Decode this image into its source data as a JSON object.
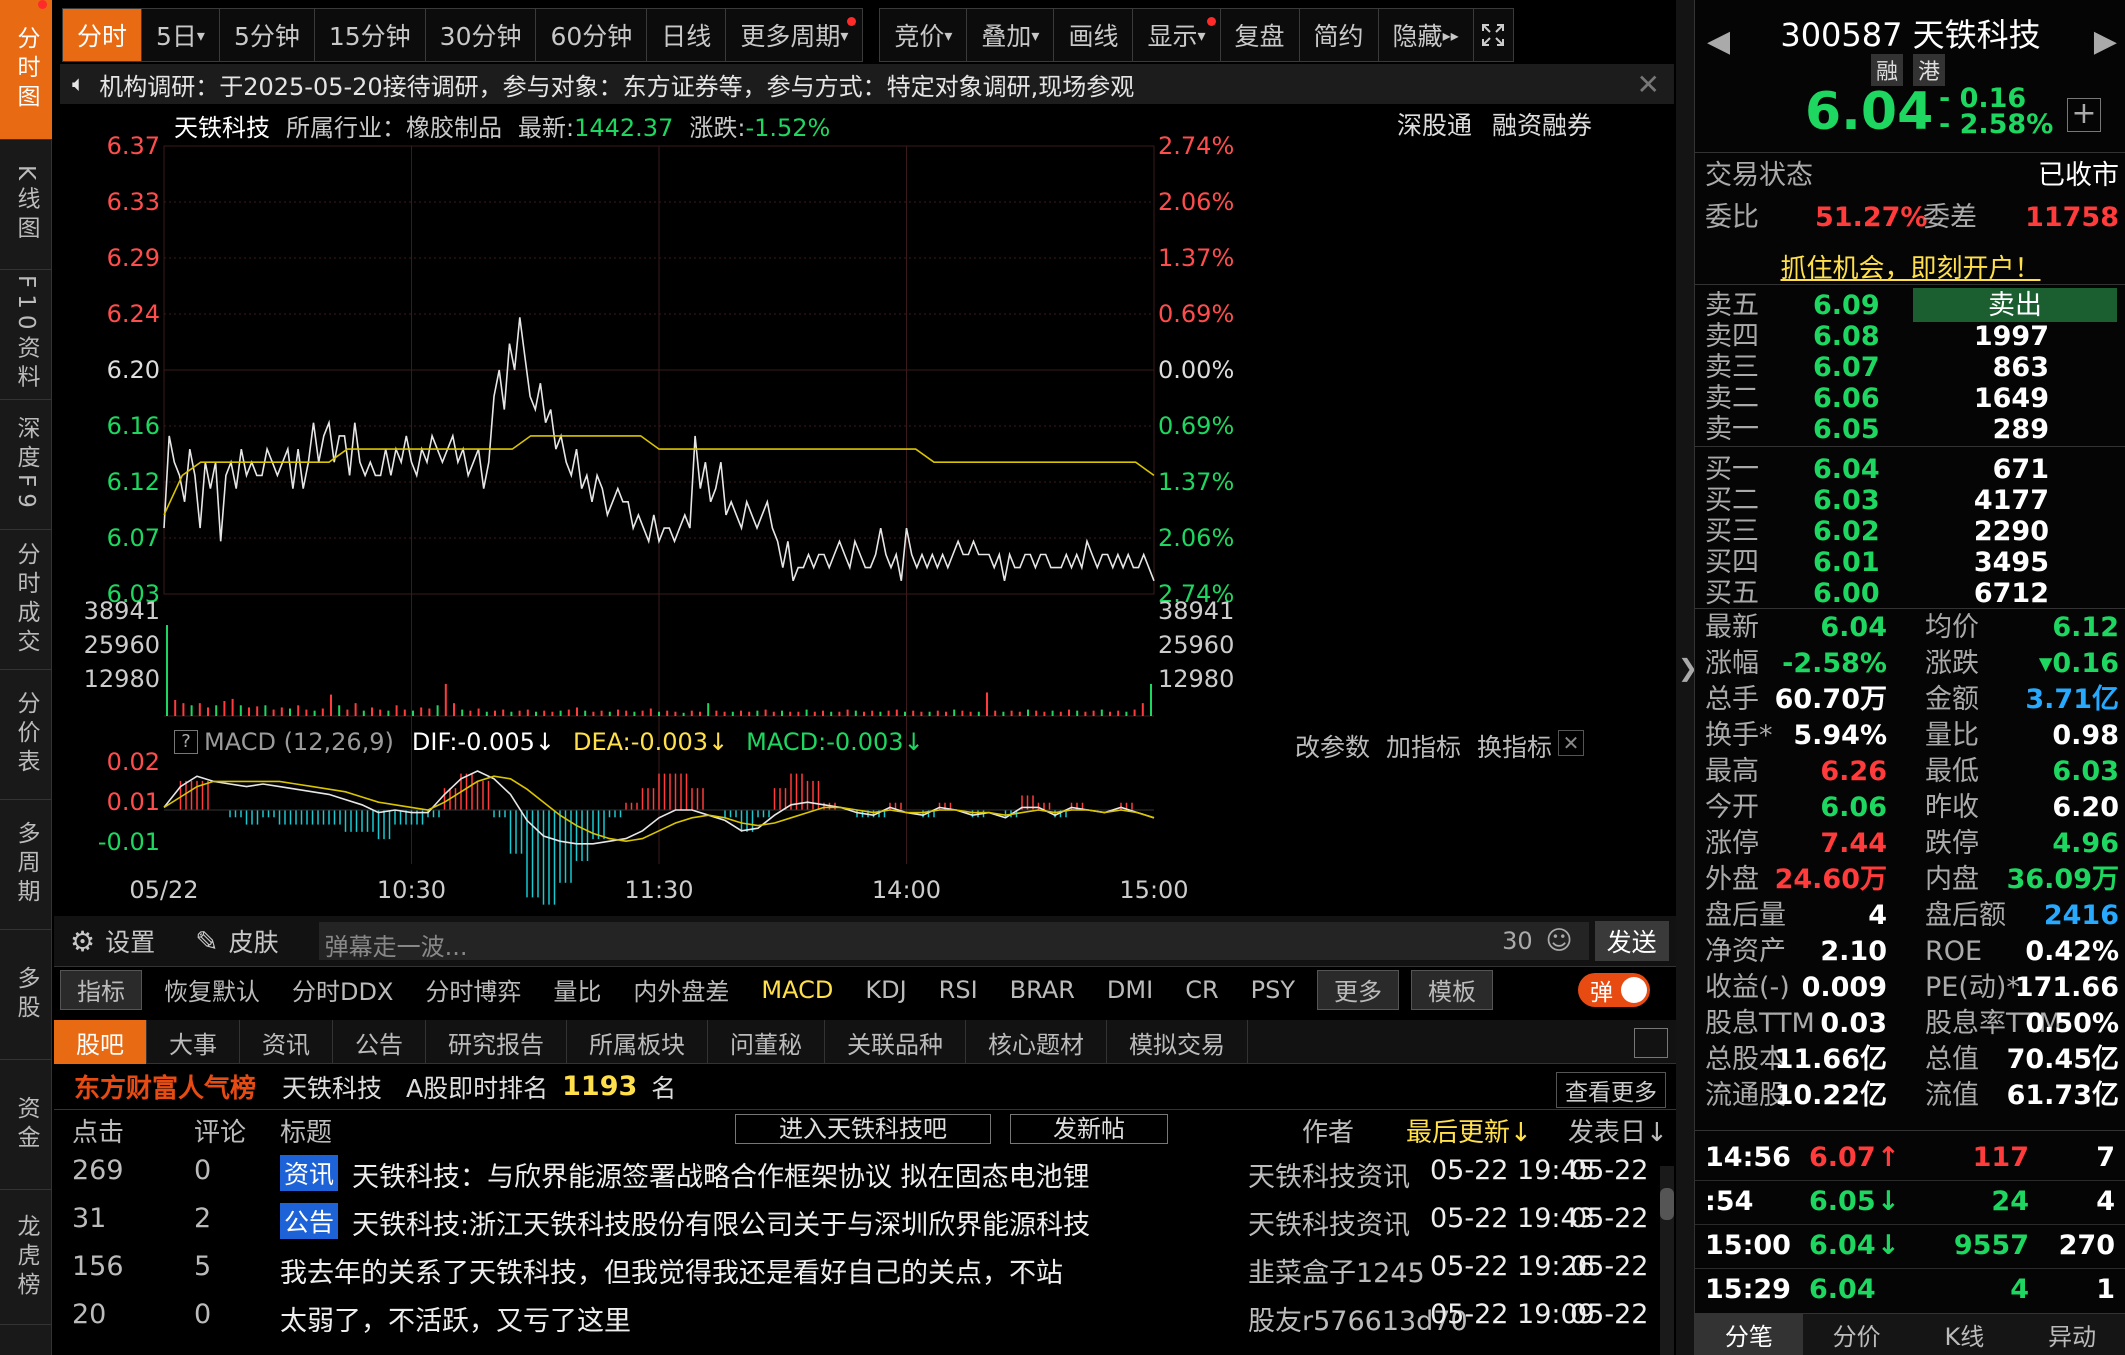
{
  "lnav": [
    {
      "label": "分时图",
      "active": true,
      "h": 140
    },
    {
      "label": "K线图",
      "active": false,
      "h": 130
    },
    {
      "label": "F10资料",
      "active": false,
      "h": 130
    },
    {
      "label": "深度F9",
      "active": false,
      "h": 130
    },
    {
      "label": "分时成交",
      "active": false,
      "h": 140
    },
    {
      "label": "分价表",
      "active": false,
      "h": 130
    },
    {
      "label": "多周期",
      "active": false,
      "h": 130
    },
    {
      "label": "多股",
      "active": false,
      "h": 130
    },
    {
      "label": "资金",
      "active": false,
      "h": 130
    },
    {
      "label": "龙虎榜",
      "active": false,
      "h": 135
    }
  ],
  "period_tabs": [
    "分时",
    "5日",
    "5分钟",
    "15分钟",
    "30分钟",
    "60分钟",
    "日线",
    "更多周期"
  ],
  "tool_tabs": [
    "竞价",
    "叠加",
    "画线",
    "显示",
    "复盘",
    "简约",
    "隐藏"
  ],
  "notice": "机构调研：于2025-05-20接待调研，参与对象：东方证券等，参与方式：特定对象调研,现场参观",
  "chart_header": {
    "name": "天铁科技",
    "industry": "所属行业：橡胶制品",
    "latest_label": "最新:",
    "latest": "1442.37",
    "change_label": "涨跌:",
    "change": "-1.52%",
    "links": [
      "深股通",
      "融资融券"
    ]
  },
  "chart_data": {
    "type": "line",
    "price_ticks": [
      "6.37",
      "6.33",
      "6.29",
      "6.24",
      "6.20",
      "6.16",
      "6.12",
      "6.07",
      "6.03"
    ],
    "pct_ticks": [
      "2.74%",
      "2.06%",
      "1.37%",
      "0.69%",
      "0.00%",
      "0.69%",
      "1.37%",
      "2.06%",
      "2.74%"
    ],
    "ylim": [
      6.03,
      6.37
    ],
    "vol_ticks": [
      "38941",
      "25960",
      "12980"
    ],
    "macd_ticks": [
      "0.02",
      "0.01",
      "-0.01"
    ],
    "x_ticks": [
      "05/22",
      "10:30",
      "11:30",
      "14:00",
      "15:00"
    ],
    "price_series": [
      6.08,
      6.15,
      6.13,
      6.12,
      6.1,
      6.14,
      6.12,
      6.08,
      6.13,
      6.11,
      6.13,
      6.07,
      6.12,
      6.13,
      6.11,
      6.14,
      6.12,
      6.13,
      6.12,
      6.12,
      6.14,
      6.13,
      6.12,
      6.13,
      6.14,
      6.11,
      6.14,
      6.11,
      6.13,
      6.16,
      6.13,
      6.15,
      6.16,
      6.13,
      6.15,
      6.15,
      6.12,
      6.16,
      6.13,
      6.12,
      6.13,
      6.12,
      6.12,
      6.14,
      6.12,
      6.14,
      6.13,
      6.15,
      6.13,
      6.12,
      6.14,
      6.13,
      6.15,
      6.14,
      6.13,
      6.14,
      6.15,
      6.13,
      6.14,
      6.12,
      6.13,
      6.14,
      6.11,
      6.13,
      6.18,
      6.2,
      6.17,
      6.22,
      6.2,
      6.24,
      6.21,
      6.18,
      6.17,
      6.19,
      6.16,
      6.17,
      6.14,
      6.15,
      6.13,
      6.12,
      6.14,
      6.11,
      6.12,
      6.1,
      6.12,
      6.11,
      6.09,
      6.1,
      6.11,
      6.1,
      6.1,
      6.08,
      6.09,
      6.08,
      6.07,
      6.09,
      6.07,
      6.08,
      6.08,
      6.07,
      6.08,
      6.09,
      6.08,
      6.15,
      6.11,
      6.13,
      6.1,
      6.11,
      6.13,
      6.09,
      6.1,
      6.09,
      6.08,
      6.1,
      6.09,
      6.08,
      6.09,
      6.1,
      6.08,
      6.07,
      6.05,
      6.07,
      6.04,
      6.05,
      6.05,
      6.06,
      6.05,
      6.06,
      6.06,
      6.05,
      6.06,
      6.07,
      6.06,
      6.05,
      6.07,
      6.06,
      6.05,
      6.05,
      6.06,
      6.08,
      6.06,
      6.05,
      6.06,
      6.04,
      6.08,
      6.06,
      6.05,
      6.06,
      6.05,
      6.06,
      6.05,
      6.06,
      6.05,
      6.06,
      6.07,
      6.06,
      6.06,
      6.07,
      6.06,
      6.06,
      6.06,
      6.05,
      6.06,
      6.04,
      6.06,
      6.05,
      6.05,
      6.06,
      6.06,
      6.05,
      6.06,
      6.06,
      6.05,
      6.05,
      6.05,
      6.06,
      6.05,
      6.06,
      6.05,
      6.07,
      6.06,
      6.05,
      6.06,
      6.06,
      6.05,
      6.06,
      6.05,
      6.06,
      6.05,
      6.05,
      6.06,
      6.05,
      6.04
    ],
    "avg_series": [
      6.09,
      6.12,
      6.13,
      6.13,
      6.13,
      6.13,
      6.13,
      6.13,
      6.13,
      6.13,
      6.14,
      6.14,
      6.14,
      6.14,
      6.14,
      6.14,
      6.14,
      6.14,
      6.14,
      6.14,
      6.15,
      6.15,
      6.15,
      6.15,
      6.15,
      6.15,
      6.15,
      6.14,
      6.14,
      6.14,
      6.14,
      6.14,
      6.14,
      6.14,
      6.14,
      6.14,
      6.14,
      6.14,
      6.14,
      6.14,
      6.14,
      6.14,
      6.13,
      6.13,
      6.13,
      6.13,
      6.13,
      6.13,
      6.13,
      6.13,
      6.13,
      6.13,
      6.13,
      6.13,
      6.12
    ],
    "vol_series": [
      0.85,
      0.15,
      0.12,
      0.1,
      0.12,
      0.08,
      0.1,
      0.14,
      0.16,
      0.1,
      0.08,
      0.09,
      0.1,
      0.06,
      0.08,
      0.07,
      0.1,
      0.06,
      0.05,
      0.07,
      0.2,
      0.1,
      0.06,
      0.12,
      0.05,
      0.08,
      0.06,
      0.05,
      0.1,
      0.06,
      0.05,
      0.08,
      0.07,
      0.1,
      0.3,
      0.12,
      0.06,
      0.05,
      0.07,
      0.04,
      0.05,
      0.06,
      0.04,
      0.05,
      0.06,
      0.04,
      0.05,
      0.04,
      0.05,
      0.06,
      0.08,
      0.05,
      0.04,
      0.05,
      0.04,
      0.06,
      0.05,
      0.04,
      0.05,
      0.07,
      0.04,
      0.05,
      0.04,
      0.03,
      0.05,
      0.04,
      0.12,
      0.05,
      0.04,
      0.04,
      0.05,
      0.04,
      0.05,
      0.06,
      0.04,
      0.05,
      0.04,
      0.04,
      0.06,
      0.04,
      0.05,
      0.04,
      0.04,
      0.06,
      0.05,
      0.04,
      0.05,
      0.04,
      0.05,
      0.06,
      0.04,
      0.05,
      0.04,
      0.04,
      0.05,
      0.04,
      0.06,
      0.05,
      0.04,
      0.04,
      0.22,
      0.05,
      0.04,
      0.05,
      0.04,
      0.06,
      0.05,
      0.04,
      0.05,
      0.04,
      0.06,
      0.05,
      0.04,
      0.05,
      0.06,
      0.04,
      0.05,
      0.04,
      0.06,
      0.12,
      0.3
    ],
    "dif_series": [
      0.001,
      0.009,
      0.013,
      0.011,
      0.01,
      0.009,
      0.01,
      0.009,
      0.008,
      0.007,
      0.006,
      0.004,
      0.002,
      -0.001,
      0.0,
      -0.001,
      -0.001,
      0.006,
      0.012,
      0.015,
      0.012,
      0.006,
      -0.004,
      -0.01,
      -0.012,
      -0.013,
      -0.013,
      -0.012,
      -0.011,
      -0.008,
      -0.003,
      -0.0,
      0.0,
      -0.002,
      -0.004,
      -0.008,
      -0.007,
      -0.002,
      0.002,
      0.003,
      0.002,
      0.001,
      -0.001,
      -0.002,
      0.001,
      -0.001,
      -0.002,
      0.001,
      0.0,
      -0.002,
      -0.001,
      -0.003,
      0.001,
      0.001,
      -0.002,
      0.001,
      0.0,
      -0.001,
      0.001,
      -0.001,
      -0.003
    ],
    "dea_series": [
      0.001,
      0.005,
      0.009,
      0.011,
      0.011,
      0.011,
      0.011,
      0.011,
      0.01,
      0.009,
      0.008,
      0.007,
      0.005,
      0.003,
      0.002,
      0.001,
      0.0,
      0.003,
      0.007,
      0.011,
      0.013,
      0.012,
      0.008,
      0.003,
      -0.002,
      -0.006,
      -0.009,
      -0.011,
      -0.012,
      -0.011,
      -0.008,
      -0.005,
      -0.003,
      -0.002,
      -0.003,
      -0.005,
      -0.006,
      -0.005,
      -0.003,
      -0.001,
      0.001,
      0.001,
      0.0,
      -0.001,
      0.0,
      -0.001,
      -0.001,
      0.0,
      0.0,
      -0.001,
      -0.001,
      -0.002,
      -0.001,
      0.0,
      -0.001,
      0.0,
      0.0,
      -0.001,
      0.0,
      -0.001,
      -0.003
    ]
  },
  "macd_header": {
    "title": "MACD (12,26,9)",
    "dif": "DIF:-0.005↓",
    "dea": "DEA:-0.003↓",
    "macd": "MACD:-0.003↓",
    "actions": [
      "改参数",
      "加指标",
      "换指标"
    ]
  },
  "danmu": {
    "settings": "设置",
    "skin": "皮肤",
    "placeholder": "弹幕走一波...",
    "count": "30",
    "send": "发送"
  },
  "indicator_tabs": [
    "指标",
    "恢复默认",
    "分时DDX",
    "分时博弈",
    "量比",
    "内外盘差",
    "MACD",
    "KDJ",
    "RSI",
    "BRAR",
    "DMI",
    "CR",
    "PSY",
    "更多",
    "模板"
  ],
  "toggle_label": "弹",
  "info_tabs": [
    "股吧",
    "大事",
    "资讯",
    "公告",
    "研究报告",
    "所属板块",
    "问董秘",
    "关联品种",
    "核心题材",
    "模拟交易"
  ],
  "rank": {
    "brand": "东方财富人气榜",
    "name": "天铁科技",
    "label": "A股即时排名",
    "value": "1193",
    "unit": "名",
    "more": "查看更多"
  },
  "forum_header": {
    "clicks": "点击",
    "comments": "评论",
    "title": "标题",
    "enter": "进入天铁科技吧",
    "post": "发新帖",
    "author": "作者",
    "updated": "最后更新↓",
    "published": "发表日↓"
  },
  "forum_rows": [
    {
      "clicks": "269",
      "comments": "0",
      "tag": "资讯",
      "title": "天铁科技：与欣界能源签署战略合作框架协议 拟在固态电池锂",
      "author": "天铁科技资讯",
      "updated": "05-22 19:45",
      "date": "05-22"
    },
    {
      "clicks": "31",
      "comments": "2",
      "tag": "公告",
      "title": "天铁科技:浙江天铁科技股份有限公司关于与深圳欣界能源科技",
      "author": "天铁科技资讯",
      "updated": "05-22 19:43",
      "date": "05-22"
    },
    {
      "clicks": "156",
      "comments": "5",
      "tag": "",
      "title": "我去年的关系了天铁科技，但我觉得我还是看好自己的关点，不站",
      "author": "韭菜盒子1245",
      "updated": "05-22 19:26",
      "date": "05-22"
    },
    {
      "clicks": "20",
      "comments": "0",
      "tag": "",
      "title": "太弱了，不活跃，又亏了这里",
      "author": "股友r576613d70",
      "updated": "05-22 19:09",
      "date": "05-22"
    }
  ],
  "quote": {
    "code_name": "300587 天铁科技",
    "badges": [
      "融",
      "港"
    ],
    "price": "6.04",
    "chg": "- 0.16",
    "pct": "- 2.58%",
    "status_label": "交易状态",
    "status": "已收市",
    "wb_label": "委比",
    "wb": "51.27%",
    "wc_label": "委差",
    "wc": "11758",
    "promo": "抓住机会，即刻开户！",
    "sells": [
      {
        "l": "卖五",
        "p": "6.09",
        "v": "卖出"
      },
      {
        "l": "卖四",
        "p": "6.08",
        "v": "1997"
      },
      {
        "l": "卖三",
        "p": "6.07",
        "v": "863"
      },
      {
        "l": "卖二",
        "p": "6.06",
        "v": "1649"
      },
      {
        "l": "卖一",
        "p": "6.05",
        "v": "289"
      }
    ],
    "buys": [
      {
        "l": "买一",
        "p": "6.04",
        "v": "671"
      },
      {
        "l": "买二",
        "p": "6.03",
        "v": "4177"
      },
      {
        "l": "买三",
        "p": "6.02",
        "v": "2290"
      },
      {
        "l": "买四",
        "p": "6.01",
        "v": "3495"
      },
      {
        "l": "买五",
        "p": "6.00",
        "v": "6712"
      }
    ],
    "stats": [
      {
        "l1": "最新",
        "v1": "6.04",
        "c1": "grn",
        "l2": "均价",
        "v2": "6.12",
        "c2": "grn"
      },
      {
        "l1": "涨幅",
        "v1": "-2.58%",
        "c1": "grn",
        "l2": "涨跌",
        "v2": "▾0.16",
        "c2": "grn"
      },
      {
        "l1": "总手",
        "v1": "60.70万",
        "c1": "wht",
        "l2": "金额",
        "v2": "3.71亿",
        "c2": "cy"
      },
      {
        "l1": "换手*",
        "v1": "5.94%",
        "c1": "wht",
        "l2": "量比",
        "v2": "0.98",
        "c2": "wht"
      },
      {
        "l1": "最高",
        "v1": "6.26",
        "c1": "red",
        "l2": "最低",
        "v2": "6.03",
        "c2": "grn"
      },
      {
        "l1": "今开",
        "v1": "6.06",
        "c1": "grn",
        "l2": "昨收",
        "v2": "6.20",
        "c2": "wht"
      },
      {
        "l1": "涨停",
        "v1": "7.44",
        "c1": "red",
        "l2": "跌停",
        "v2": "4.96",
        "c2": "grn"
      },
      {
        "l1": "外盘",
        "v1": "24.60万",
        "c1": "red",
        "l2": "内盘",
        "v2": "36.09万",
        "c2": "grn"
      },
      {
        "l1": "盘后量",
        "v1": "4",
        "c1": "wht",
        "l2": "盘后额",
        "v2": "2416",
        "c2": "cy"
      },
      {
        "l1": "净资产",
        "v1": "2.10",
        "c1": "wht",
        "l2": "ROE",
        "v2": "0.42%",
        "c2": "wht"
      },
      {
        "l1": "收益(-)",
        "v1": "0.009",
        "c1": "wht",
        "l2": "PE(动)*",
        "v2": "171.66",
        "c2": "wht"
      },
      {
        "l1": "股息TTM",
        "v1": "0.03",
        "c1": "wht",
        "l2": "股息率TTM",
        "v2": "0.50%",
        "c2": "wht"
      },
      {
        "l1": "总股本",
        "v1": "11.66亿",
        "c1": "wht",
        "l2": "总值",
        "v2": "70.45亿",
        "c2": "wht"
      },
      {
        "l1": "流通股",
        "v1": "10.22亿",
        "c1": "wht",
        "l2": "流值",
        "v2": "61.73亿",
        "c2": "wht"
      }
    ],
    "ticks": [
      {
        "t": "14:56",
        "p": "6.07",
        "arr": "↑",
        "ac": "red",
        "v": "117",
        "vc": "red",
        "n": "7"
      },
      {
        "t": ":54",
        "p": "6.05",
        "arr": "↓",
        "ac": "grn",
        "v": "24",
        "vc": "grn",
        "n": "4"
      },
      {
        "t": "15:00",
        "p": "6.04",
        "arr": "↓",
        "ac": "grn",
        "v": "9557",
        "vc": "grn",
        "n": "270"
      },
      {
        "t": "15:29",
        "p": "6.04",
        "arr": "",
        "ac": "grn",
        "v": "4",
        "vc": "grn",
        "n": "1"
      }
    ],
    "bottom_tabs": [
      "分笔",
      "分价",
      "K线",
      "异动"
    ]
  }
}
